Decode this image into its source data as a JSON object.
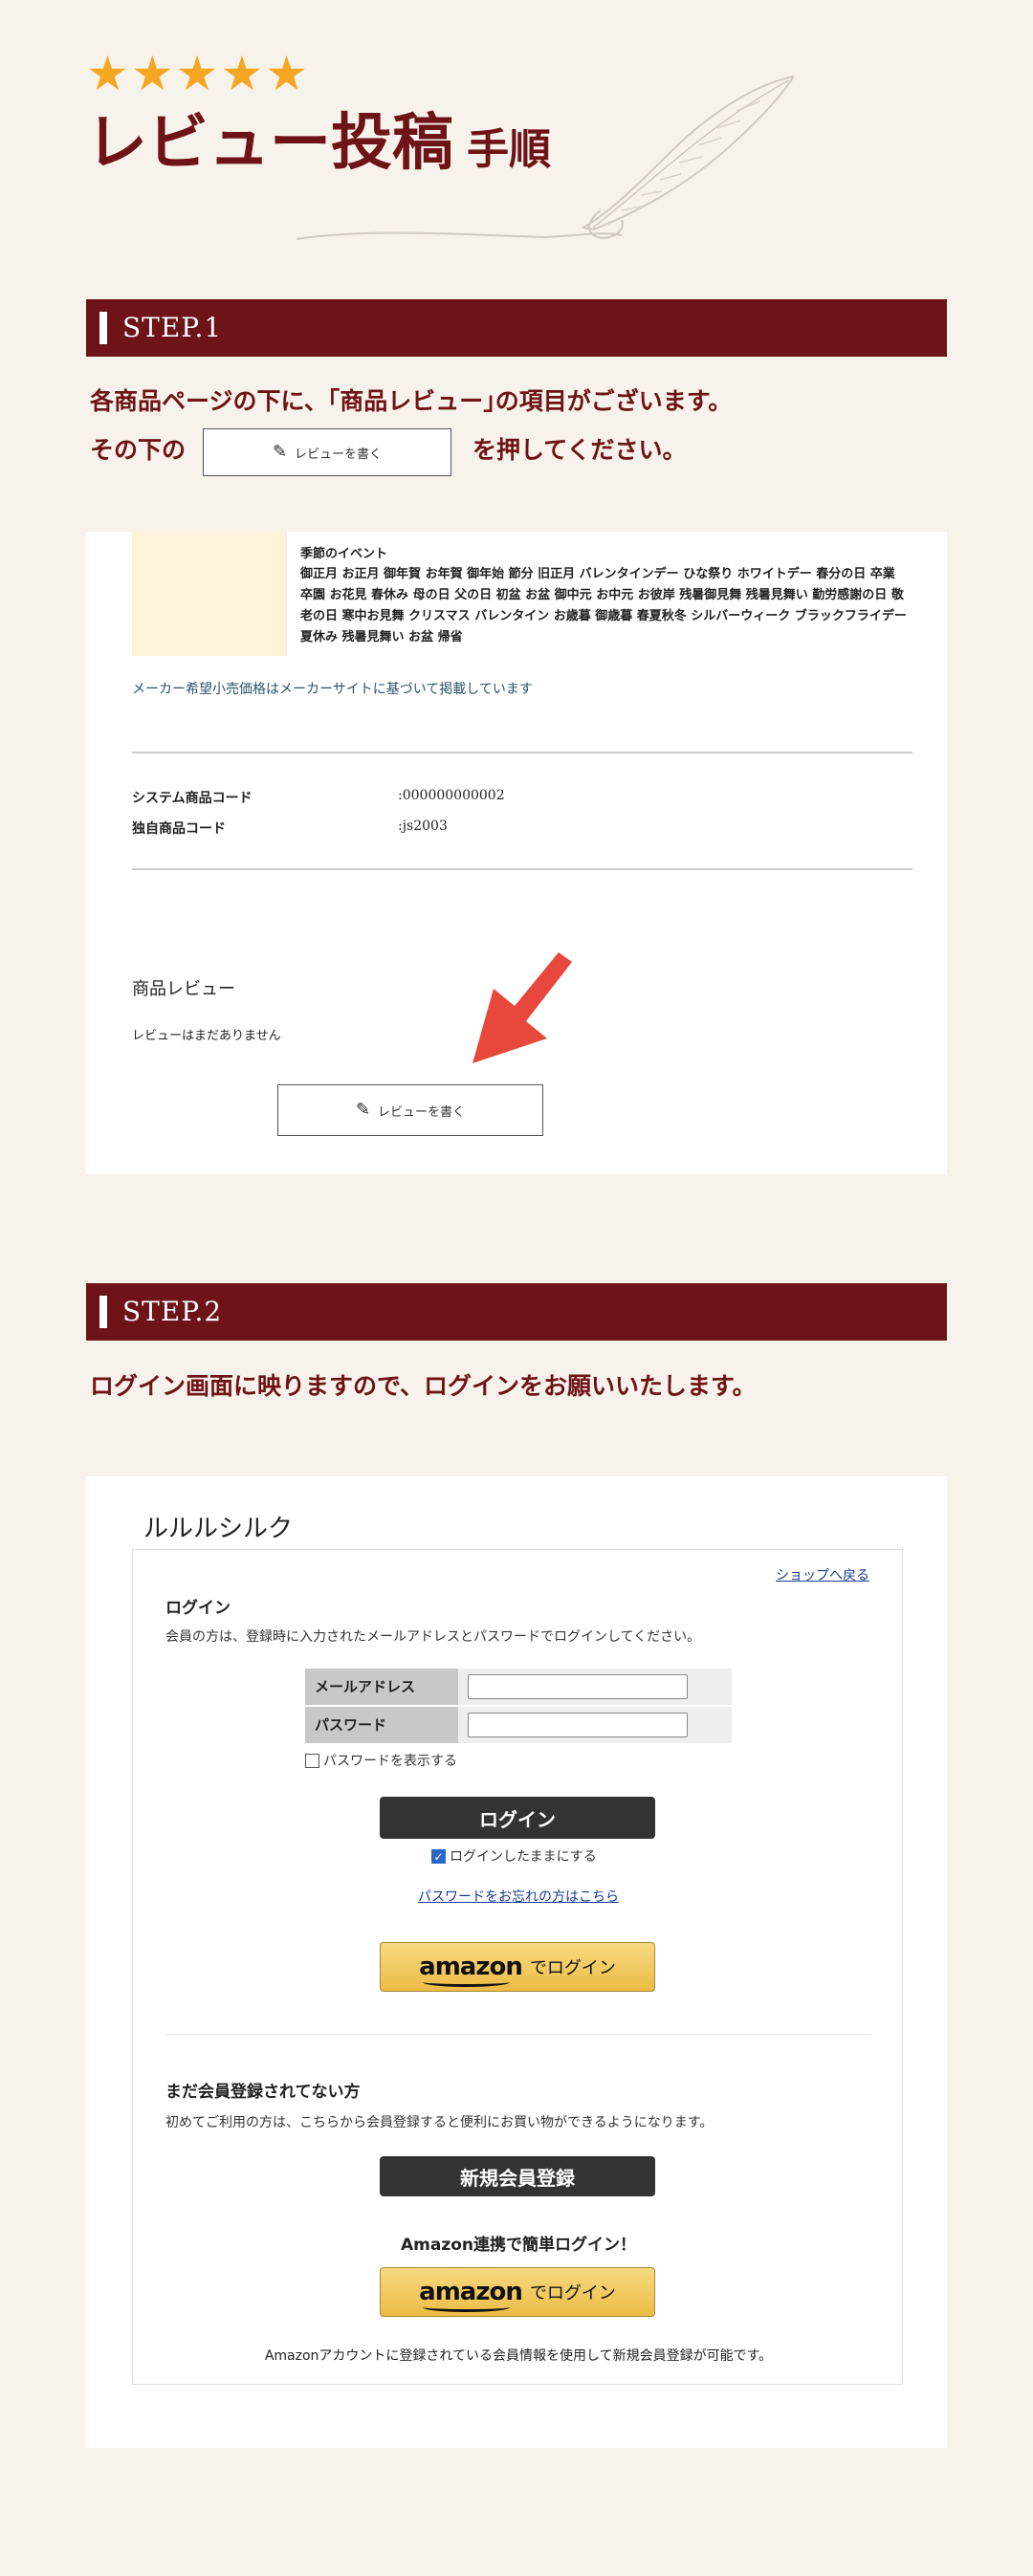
{
  "header": {
    "stars": "★★★★★",
    "title": "レビュー投稿",
    "title_suffix": "手順"
  },
  "step1": {
    "label": "STEP.1",
    "line1": "各商品ページの下に、｢商品レビュー｣の項目がございます。",
    "line2_prefix": "その下の",
    "line2_suffix": "を押してください。",
    "inline_button": "レビューを書く",
    "event_title": "季節のイベント",
    "event_text": "御正月 お正月 御年賀 お年賀 御年始 節分 旧正月 バレンタインデー ひな祭り ホワイトデー 春分の日 卒業 卒園 お花見 春休み 母の日 父の日 初盆 お盆 御中元 お中元 お彼岸 残暑御見舞 残暑見舞い 勤労感謝の日 敬老の日 寒中お見舞 クリスマス バレンタイン お歳暮 御歳暮 春夏秋冬 シルバーウィーク ブラックフライデー 夏休み 残暑見舞い お盆 帰省",
    "maker_note": "メーカー希望小売価格はメーカーサイトに基づいて掲載しています",
    "codes": [
      {
        "label": "システム商品コード",
        "value": ":000000000002"
      },
      {
        "label": "独自商品コード",
        "value": ":js2003"
      }
    ],
    "review_heading": "商品レビュー",
    "no_review": "レビューはまだありません",
    "write_review_button": "レビューを書く"
  },
  "step2": {
    "label": "STEP.2",
    "line1": "ログイン画面に映りますので、ログインをお願いいたします。",
    "shop_name": "ルルルシルク",
    "back_link": "ショップへ戻る",
    "login_title": "ログイン",
    "login_desc": "会員の方は、登録時に入力されたメールアドレスとパスワードでログインしてください。",
    "email_label": "メールアドレス",
    "password_label": "パスワード",
    "show_password": "パスワードを表示する",
    "login_button": "ログイン",
    "stay_logged_in": "ログインしたままにする",
    "forgot_password": "パスワードをお忘れの方はこちら",
    "amazon_logo": "amazon",
    "amazon_login": "でログイン",
    "not_member_title": "まだ会員登録されてない方",
    "not_member_desc": "初めてご利用の方は、こちらから会員登録すると便利にお買い物ができるようになります。",
    "register_button": "新規会員登録",
    "amazon_easy": "Amazon連携で簡単ログイン！",
    "amazon_note": "Amazonアカウントに登録されている会員情報を使用して新規会員登録が可能です。"
  },
  "colors": {
    "background": "#f8f3ea",
    "accent": "#6e1318",
    "star": "#f5a623",
    "arrow": "#e8473b"
  },
  "icons": [
    "star-icon",
    "feather-icon",
    "pencil-icon",
    "arrow-icon",
    "checkbox-icon"
  ]
}
